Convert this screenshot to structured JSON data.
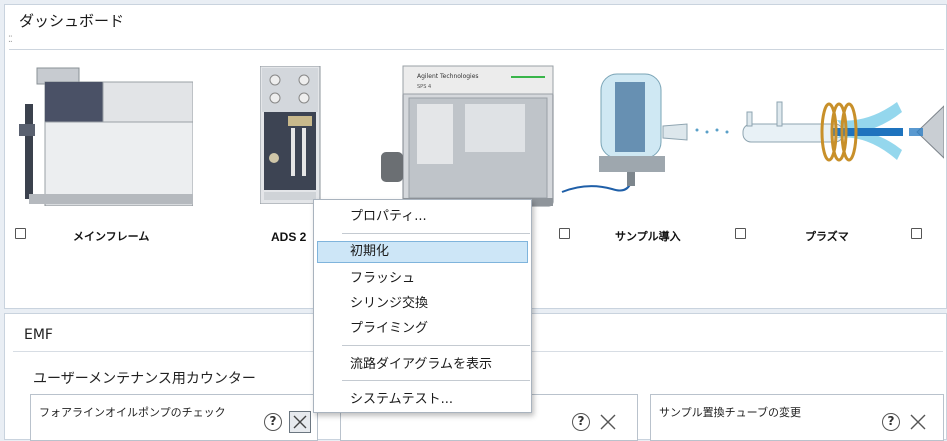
{
  "dashboard": {
    "title": "ダッシュボード",
    "modules": [
      {
        "label": "メインフレーム",
        "icon": "mainframe-instrument-icon",
        "checked": false
      },
      {
        "label": "ADS 2",
        "icon": "ads2-autosampler-icon",
        "checked": false
      },
      {
        "label": "",
        "icon": "agilent-spectrometer-icon",
        "checked": false
      },
      {
        "label": "サンプル導入",
        "icon": "sample-introduction-icon",
        "checked": false
      },
      {
        "label": "プラズマ",
        "icon": "plasma-torch-icon",
        "checked": false
      },
      {
        "label": "",
        "icon": "interface-cone-icon",
        "checked": false
      }
    ],
    "instrument_badge": {
      "line1": "Agilent Technologies",
      "line2": "SPS 4"
    }
  },
  "context_menu": {
    "items": [
      {
        "label": "プロパティ...",
        "highlighted": false
      },
      {
        "label": "初期化",
        "highlighted": true
      },
      {
        "label": "フラッシュ",
        "highlighted": false
      },
      {
        "label": "シリンジ交換",
        "highlighted": false
      },
      {
        "label": "プライミング",
        "highlighted": false
      },
      {
        "label": "流路ダイアグラムを表示",
        "highlighted": false
      },
      {
        "label": "システムテスト...",
        "highlighted": false
      }
    ]
  },
  "emf": {
    "title": "EMF",
    "counter_section_title": "ユーザーメンテナンス用カウンター",
    "cards": [
      {
        "title": "フォアラインオイルポンプのチェック"
      },
      {
        "title": ""
      },
      {
        "title": "サンプル置換チューブの変更"
      }
    ]
  },
  "colors": {
    "menu_highlight": "#cde6f7",
    "accent_blue": "#1e73be"
  }
}
